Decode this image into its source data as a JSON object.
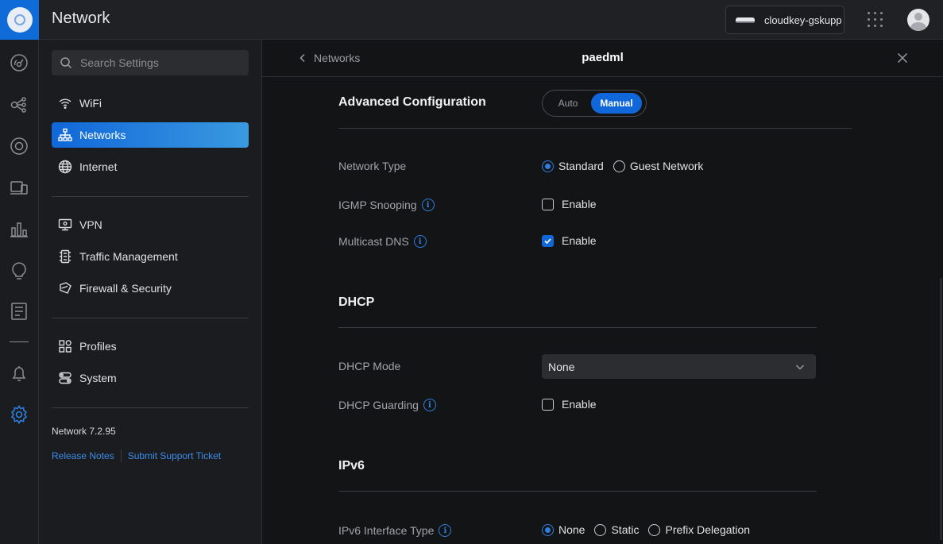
{
  "app": {
    "title": "Network",
    "device_name": "cloudkey-gskupp"
  },
  "rail": {
    "icons": [
      "dashboard-icon",
      "topology-icon",
      "devices-icon",
      "clients-icon",
      "statistics-icon",
      "insights-icon",
      "logs-icon",
      "alerts-icon",
      "settings-icon"
    ]
  },
  "sidebar": {
    "search_placeholder": "Search Settings",
    "items": [
      {
        "label": "WiFi",
        "icon": "wifi-icon"
      },
      {
        "label": "Networks",
        "icon": "networks-icon",
        "active": true
      },
      {
        "label": "Internet",
        "icon": "globe-icon"
      },
      {
        "label": "VPN",
        "icon": "vpn-icon"
      },
      {
        "label": "Traffic Management",
        "icon": "traffic-icon"
      },
      {
        "label": "Firewall & Security",
        "icon": "shield-icon"
      },
      {
        "label": "Profiles",
        "icon": "profiles-icon"
      },
      {
        "label": "System",
        "icon": "system-icon"
      }
    ],
    "version": "Network 7.2.95",
    "release_notes": "Release Notes",
    "support_ticket": "Submit Support Ticket"
  },
  "panel": {
    "back_label": "Networks",
    "title": "paedml",
    "advanced": {
      "title": "Advanced Configuration",
      "mode_auto": "Auto",
      "mode_manual": "Manual",
      "selected": "Manual"
    },
    "network_type": {
      "label": "Network Type",
      "options": [
        "Standard",
        "Guest Network"
      ],
      "selected": "Standard"
    },
    "igmp": {
      "label": "IGMP Snooping",
      "checkbox_label": "Enable",
      "checked": false
    },
    "mdns": {
      "label": "Multicast DNS",
      "checkbox_label": "Enable",
      "checked": true
    },
    "dhcp": {
      "title": "DHCP",
      "mode_label": "DHCP Mode",
      "mode_value": "None",
      "guarding_label": "DHCP Guarding",
      "guarding_checkbox_label": "Enable",
      "guarding_checked": false
    },
    "ipv6": {
      "title": "IPv6",
      "interface_label": "IPv6 Interface Type",
      "options": [
        "None",
        "Static",
        "Prefix Delegation"
      ],
      "selected": "None"
    }
  }
}
